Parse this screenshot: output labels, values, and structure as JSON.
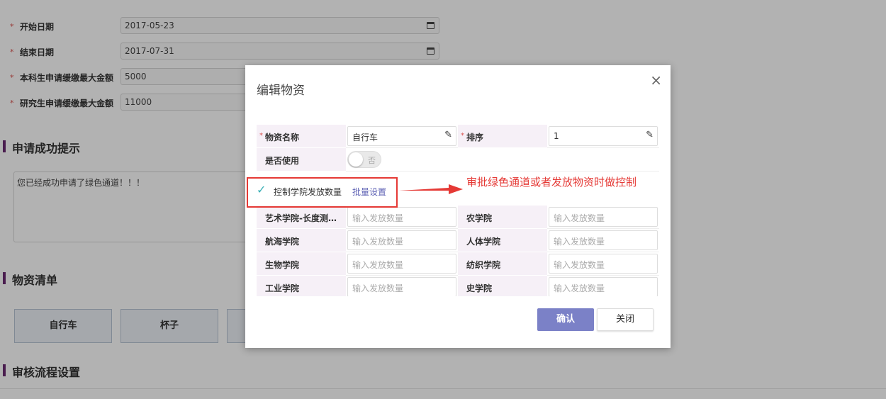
{
  "form": {
    "rows": [
      {
        "label": "开始日期",
        "value": "2017-05-23",
        "calendar": true
      },
      {
        "label": "结束日期",
        "value": "2017-07-31",
        "calendar": true
      },
      {
        "label": "本科生申请缓缴最大金额",
        "value": "5000"
      },
      {
        "label": "研究生申请缓缴最大金额",
        "value": "11000"
      }
    ],
    "required_mark": "*"
  },
  "sections": {
    "success_tip": "申请成功提示",
    "goods_list": "物资清单",
    "approval_flow": "审核流程设置"
  },
  "success_message": "您已经成功申请了绿色通道！！！",
  "goods_cards": [
    "自行车",
    "杯子"
  ],
  "modal": {
    "title": "编辑物资",
    "close_icon": "×",
    "name_label": "物资名称",
    "name_value": "自行车",
    "order_label": "排序",
    "order_value": "1",
    "enabled_label": "是否使用",
    "toggle_text": "否",
    "control_label": "控制学院发放数量",
    "batch_link": "批量设置",
    "check_icon": "✓",
    "pencil_icon": "✎",
    "placeholder": "输入发放数量",
    "colleges": [
      [
        "艺术学院-长度测…",
        "农学院"
      ],
      [
        "航海学院",
        "人体学院"
      ],
      [
        "生物学院",
        "纺织学院"
      ],
      [
        "工业学院",
        "史学院"
      ]
    ],
    "confirm": "确认",
    "cancel": "关闭"
  },
  "annotation": {
    "text": "审批绿色通道或者发放物资时做控制",
    "color": "#e53935"
  }
}
